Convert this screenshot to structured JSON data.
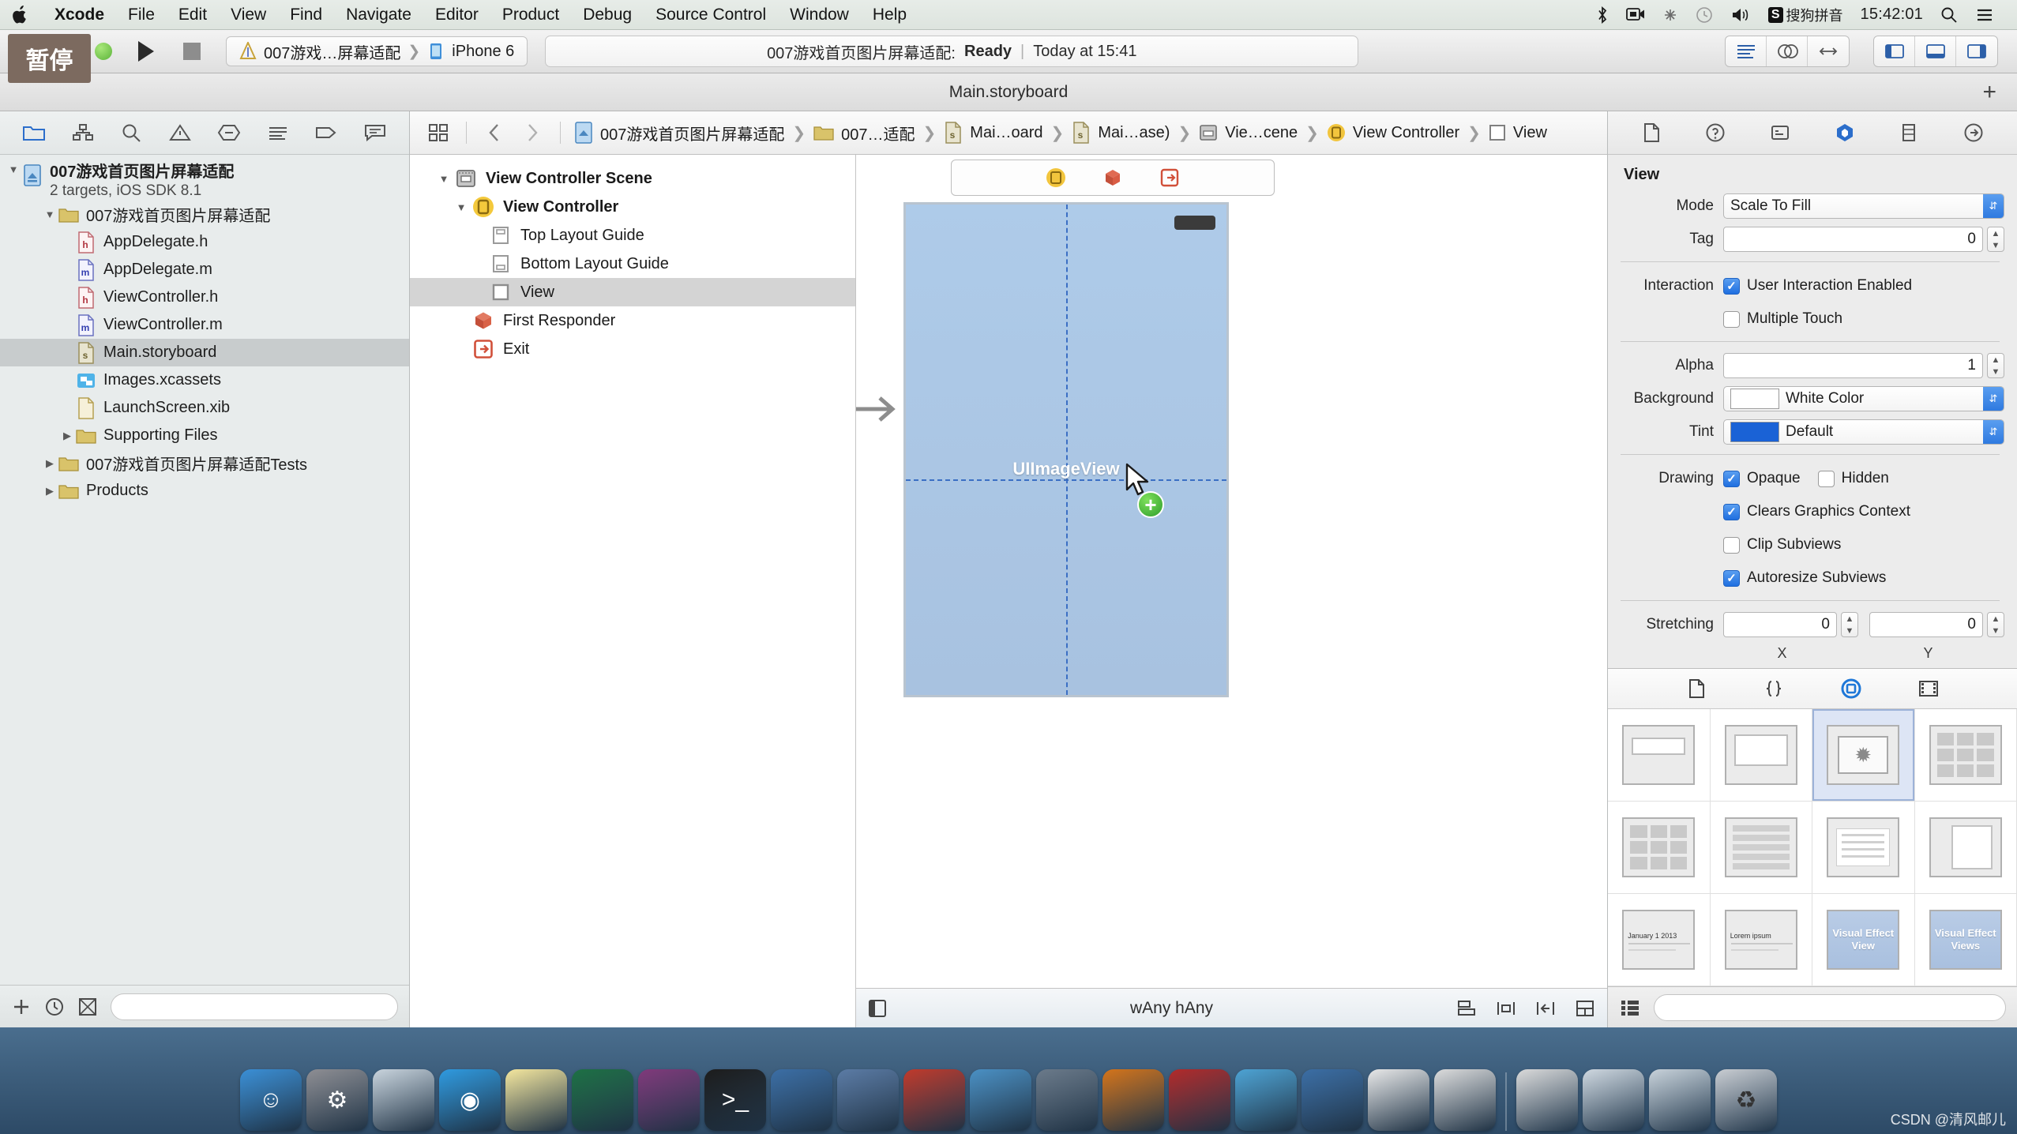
{
  "menubar": {
    "apple": "apple-logo",
    "items": [
      {
        "label": "Xcode",
        "bold": true
      },
      {
        "label": "File",
        "bold": false
      },
      {
        "label": "Edit",
        "bold": false
      },
      {
        "label": "View",
        "bold": false
      },
      {
        "label": "Find",
        "bold": false
      },
      {
        "label": "Navigate",
        "bold": false
      },
      {
        "label": "Editor",
        "bold": false
      },
      {
        "label": "Product",
        "bold": false
      },
      {
        "label": "Debug",
        "bold": false
      },
      {
        "label": "Source Control",
        "bold": false
      },
      {
        "label": "Window",
        "bold": false
      },
      {
        "label": "Help",
        "bold": false
      }
    ],
    "status": {
      "bluetooth": "bluetooth-icon",
      "screen_share": "screen-share-icon",
      "dropbox": "dropbox-icon",
      "time_machine": "time-machine-icon",
      "volume": "volume-icon",
      "input_badge": "S",
      "input_method": "搜狗拼音",
      "clock": "15:42:01",
      "spotlight": "search-icon",
      "notifications": "notification-center-icon"
    }
  },
  "toolbar": {
    "pause_label": "暂停",
    "run_button": "run-button",
    "stop_button": "stop-button",
    "scheme": "007游戏…屏幕适配",
    "destination": "iPhone 6",
    "status_project": "007游戏首页图片屏幕适配:",
    "status_state": "Ready",
    "status_separator": "|",
    "status_time": "Today at 15:41",
    "editor_segments": [
      "standard-editor-icon",
      "assistant-editor-icon",
      "version-editor-icon"
    ],
    "panel_segments": [
      "hide-navigator-icon",
      "hide-debug-icon",
      "hide-utilities-icon"
    ]
  },
  "window": {
    "title": "Main.storyboard",
    "add_button": "+"
  },
  "navigator": {
    "tabs": [
      "folder-icon",
      "source-control-icon",
      "search-icon",
      "warning-icon",
      "breakpoint-icon",
      "report-icon",
      "tag-icon",
      "comment-icon"
    ],
    "project_name": "007游戏首页图片屏幕适配",
    "project_subtitle": "2 targets, iOS SDK 8.1",
    "items": [
      {
        "label": "007游戏首页图片屏幕适配",
        "icon": "folder-yellow-icon",
        "indent": 2,
        "disclosure": "open",
        "selected": false
      },
      {
        "label": "AppDelegate.h",
        "icon": "header-file-icon",
        "indent": 3,
        "disclosure": "none",
        "selected": false
      },
      {
        "label": "AppDelegate.m",
        "icon": "implementation-file-icon",
        "indent": 3,
        "disclosure": "none",
        "selected": false
      },
      {
        "label": "ViewController.h",
        "icon": "header-file-icon",
        "indent": 3,
        "disclosure": "none",
        "selected": false
      },
      {
        "label": "ViewController.m",
        "icon": "implementation-file-icon",
        "indent": 3,
        "disclosure": "none",
        "selected": false
      },
      {
        "label": "Main.storyboard",
        "icon": "storyboard-file-icon",
        "indent": 3,
        "disclosure": "none",
        "selected": true
      },
      {
        "label": "Images.xcassets",
        "icon": "assets-icon",
        "indent": 3,
        "disclosure": "none",
        "selected": false
      },
      {
        "label": "LaunchScreen.xib",
        "icon": "xib-file-icon",
        "indent": 3,
        "disclosure": "none",
        "selected": false
      },
      {
        "label": "Supporting Files",
        "icon": "folder-yellow-icon",
        "indent": 3,
        "disclosure": "closed",
        "selected": false
      },
      {
        "label": "007游戏首页图片屏幕适配Tests",
        "icon": "folder-yellow-icon",
        "indent": 2,
        "disclosure": "closed",
        "selected": false
      },
      {
        "label": "Products",
        "icon": "folder-yellow-icon",
        "indent": 2,
        "disclosure": "closed",
        "selected": false
      }
    ],
    "footer": {
      "add": "add-icon",
      "recent": "recent-icon",
      "filter": "filter-icon",
      "placeholder": ""
    }
  },
  "jumpbar": {
    "related_icon": "related-files-icon",
    "back": "back-chevron-icon",
    "forward": "forward-chevron-icon",
    "crumbs": [
      {
        "label": "007游戏首页图片屏幕适配",
        "icon": "project-icon"
      },
      {
        "label": "007…适配",
        "icon": "folder-yellow-icon"
      },
      {
        "label": "Mai…oard",
        "icon": "storyboard-file-icon"
      },
      {
        "label": "Mai…ase)",
        "icon": "storyboard-file-icon"
      },
      {
        "label": "Vie…cene",
        "icon": "scene-icon"
      },
      {
        "label": "View Controller",
        "icon": "view-controller-icon"
      },
      {
        "label": "View",
        "icon": "view-icon"
      }
    ]
  },
  "outline": {
    "items": [
      {
        "label": "View Controller Scene",
        "icon": "scene-icon",
        "indent": 1,
        "disclosure": "open",
        "bold": true,
        "selected": false
      },
      {
        "label": "View Controller",
        "icon": "view-controller-icon",
        "indent": 2,
        "disclosure": "open",
        "bold": true,
        "selected": false
      },
      {
        "label": "Top Layout Guide",
        "icon": "top-layout-guide-icon",
        "indent": 3,
        "disclosure": "none",
        "bold": false,
        "selected": false
      },
      {
        "label": "Bottom Layout Guide",
        "icon": "bottom-layout-guide-icon",
        "indent": 3,
        "disclosure": "none",
        "bold": false,
        "selected": false
      },
      {
        "label": "View",
        "icon": "view-icon",
        "indent": 3,
        "disclosure": "none",
        "bold": false,
        "selected": true
      },
      {
        "label": "First Responder",
        "icon": "first-responder-icon",
        "indent": 2,
        "disclosure": "none",
        "bold": false,
        "selected": false
      },
      {
        "label": "Exit",
        "icon": "exit-icon",
        "indent": 2,
        "disclosure": "none",
        "bold": false,
        "selected": false
      }
    ]
  },
  "canvas": {
    "scene_dock": [
      "view-controller-icon",
      "first-responder-icon",
      "exit-icon"
    ],
    "view_label": "UIImageView",
    "size_class": "wAny hAny",
    "bottom_left_icon": "toggle-document-outline-icon",
    "bottom_right_icons": [
      "align-icon",
      "pin-icon",
      "resolve-issues-icon",
      "resizing-behavior-icon"
    ]
  },
  "inspector": {
    "tabs": [
      "file-inspector-icon",
      "quick-help-icon",
      "identity-inspector-icon",
      "attributes-inspector-icon",
      "size-inspector-icon",
      "connections-inspector-icon"
    ],
    "section_title": "View",
    "fields": {
      "mode_label": "Mode",
      "mode_value": "Scale To Fill",
      "tag_label": "Tag",
      "tag_value": "0",
      "interaction_label": "Interaction",
      "user_interaction_label": "User Interaction Enabled",
      "user_interaction_checked": true,
      "multiple_touch_label": "Multiple Touch",
      "multiple_touch_checked": false,
      "alpha_label": "Alpha",
      "alpha_value": "1",
      "background_label": "Background",
      "background_value": "White Color",
      "background_swatch": "#ffffff",
      "tint_label": "Tint",
      "tint_value": "Default",
      "tint_swatch": "#1a62d6",
      "drawing_label": "Drawing",
      "opaque_label": "Opaque",
      "opaque_checked": true,
      "hidden_label": "Hidden",
      "hidden_checked": false,
      "clears_graphics_label": "Clears Graphics Context",
      "clears_graphics_checked": true,
      "clip_subviews_label": "Clip Subviews",
      "clip_subviews_checked": false,
      "autoresize_label": "Autoresize Subviews",
      "autoresize_checked": true,
      "stretching_label": "Stretching",
      "stretching_x": "0",
      "stretching_y": "0",
      "axis_x_label": "X",
      "axis_y_label": "Y"
    }
  },
  "library": {
    "tabs": [
      "file-template-library-icon",
      "code-snippet-library-icon",
      "object-library-icon",
      "media-library-icon"
    ],
    "selected_tab_index": 2,
    "items": [
      {
        "name": "view-thumb",
        "label": "",
        "selected": false
      },
      {
        "name": "container-view-thumb",
        "label": "",
        "selected": false
      },
      {
        "name": "image-view-thumb",
        "label": "",
        "selected": true
      },
      {
        "name": "collection-view-thumb",
        "label": "",
        "selected": false
      },
      {
        "name": "collection-reusable-view-thumb",
        "label": "",
        "selected": false
      },
      {
        "name": "table-view-thumb",
        "label": "",
        "selected": false
      },
      {
        "name": "text-view-thumb",
        "label": "",
        "selected": false
      },
      {
        "name": "scroll-view-thumb",
        "label": "",
        "selected": false
      },
      {
        "name": "date-picker-thumb",
        "label": "January  1  2013",
        "selected": false
      },
      {
        "name": "picker-view-thumb",
        "label": "Lorem ipsum",
        "selected": false
      },
      {
        "name": "visual-effect-view-thumb",
        "label": "Visual Effect View",
        "selected": false
      },
      {
        "name": "visual-effect-views-thumb",
        "label": "Visual Effect Views",
        "selected": false
      }
    ],
    "footer": {
      "list_icon": "list-view-icon",
      "filter_icon": "filter-icon",
      "placeholder": ""
    }
  },
  "dock": {
    "items": [
      {
        "name": "finder-icon",
        "color": "#3a8fd6"
      },
      {
        "name": "system-preferences-icon",
        "color": "#8e8e93"
      },
      {
        "name": "launchpad-icon",
        "color": "#c9d4dd"
      },
      {
        "name": "safari-icon",
        "color": "#2e9ae0"
      },
      {
        "name": "notes-icon",
        "color": "#f5e79e"
      },
      {
        "name": "excel-icon",
        "color": "#1d7044"
      },
      {
        "name": "onenote-icon",
        "color": "#80397b"
      },
      {
        "name": "terminal-icon",
        "color": "#1c1c1c"
      },
      {
        "name": "xcode-icon",
        "color": "#3b6ea5"
      },
      {
        "name": "instruments-icon",
        "color": "#5b7ba5"
      },
      {
        "name": "reality-composer-icon",
        "color": "#c0392b"
      },
      {
        "name": "tools-icon",
        "color": "#4a90c4"
      },
      {
        "name": "imovie-icon",
        "color": "#6b7a8a"
      },
      {
        "name": "vlc-icon",
        "color": "#d4741a"
      },
      {
        "name": "filezilla-icon",
        "color": "#b22a2a"
      },
      {
        "name": "graphics-app-icon",
        "color": "#4da3d4"
      },
      {
        "name": "navicat-icon",
        "color": "#3b6ea5"
      },
      {
        "name": "font-book-icon",
        "color": "#e8e8e8"
      },
      {
        "name": "preview-icon",
        "color": "#dcdcdc"
      }
    ],
    "right_items": [
      {
        "name": "downloads-stack-icon",
        "color": "#dadada"
      },
      {
        "name": "documents-stack-icon",
        "color": "#cfd8e0"
      },
      {
        "name": "applications-stack-icon",
        "color": "#c8d2da"
      },
      {
        "name": "trash-icon",
        "color": "#c9cdd2"
      }
    ]
  },
  "watermark": "CSDN @清风邮儿"
}
